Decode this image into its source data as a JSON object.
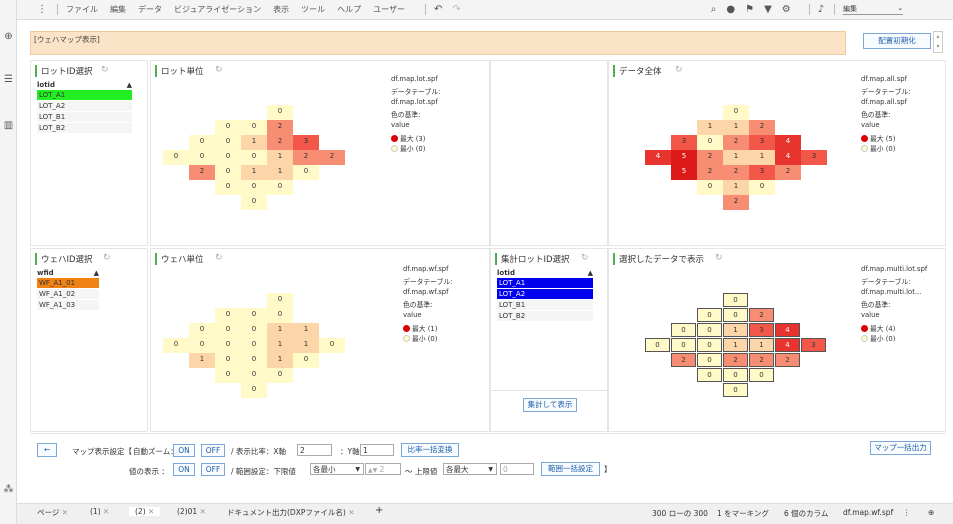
{
  "menu": {
    "items": [
      "ファイル",
      "編集",
      "データ",
      "ビジュアライゼーション",
      "表示",
      "ツール",
      "ヘルプ",
      "ユーザー"
    ],
    "user_label": "編集"
  },
  "banner": {
    "title": "[ウェハマップ表示]",
    "reset_button": "配置初期化"
  },
  "lot_select": {
    "title": "ロットID選択",
    "header": "lotid",
    "items": [
      "LOT_A1",
      "LOT_A2",
      "LOT_B1",
      "LOT_B2"
    ],
    "selected_color": "#22ee22"
  },
  "wafer_select": {
    "title": "ウェハID選択",
    "header": "wfid",
    "items": [
      "WF_A1_01",
      "WF_A1_02",
      "WF_A1_03"
    ],
    "selected_color": "#f08214"
  },
  "agg_select": {
    "title": "集計ロットID選択",
    "header": "lotid",
    "items": [
      "LOT_A1",
      "LOT_A2",
      "LOT_B1",
      "LOT_B2"
    ],
    "selected_color": "#0000ee",
    "button": "集計して表示"
  },
  "map_lot": {
    "title": "ロット単位",
    "file": "df.map.lot.spf",
    "table_label": "データテーブル:",
    "table_value": "df.map.lot.spf",
    "color_label": "色の基準:",
    "color_value": "value",
    "max_label": "最大 (3)",
    "min_label": "最小 (0)",
    "cells": [
      [
        "",
        "",
        "",
        "",
        "0",
        "",
        "",
        ""
      ],
      [
        "",
        "",
        "0",
        "0",
        "2",
        "",
        "",
        ""
      ],
      [
        "",
        "0",
        "0",
        "1",
        "2",
        "3",
        "",
        ""
      ],
      [
        "0",
        "0",
        "0",
        "0",
        "1",
        "2",
        "2",
        ""
      ],
      [
        "",
        "2",
        "0",
        "1",
        "1",
        "0",
        "",
        ""
      ],
      [
        "",
        "",
        "0",
        "0",
        "0",
        "",
        "",
        ""
      ],
      [
        "",
        "",
        "",
        "0",
        "",
        "",
        "",
        ""
      ]
    ]
  },
  "map_all": {
    "title": "データ全体",
    "file": "df.map.all.spf",
    "table_label": "データテーブル:",
    "table_value": "df.map.all.spf",
    "color_label": "色の基準:",
    "color_value": "value",
    "max_label": "最大 (5)",
    "min_label": "最小 (0)",
    "cells": [
      [
        "",
        "",
        "",
        "",
        "0",
        "",
        "",
        ""
      ],
      [
        "",
        "",
        "",
        "1",
        "1",
        "2",
        "",
        ""
      ],
      [
        "",
        "",
        "3",
        "0",
        "2",
        "3",
        "4",
        ""
      ],
      [
        "",
        "4",
        "5",
        "2",
        "1",
        "1",
        "4",
        "3"
      ],
      [
        "",
        "",
        "5",
        "2",
        "2",
        "3",
        "2",
        ""
      ],
      [
        "",
        "",
        "",
        "0",
        "1",
        "0",
        "",
        ""
      ],
      [
        "",
        "",
        "",
        "",
        "2",
        "",
        "",
        ""
      ]
    ]
  },
  "map_wafer": {
    "title": "ウェハ単位",
    "file": "df.map.wf.spf",
    "table_label": "データテーブル:",
    "table_value": "df.map.wf.spf",
    "color_label": "色の基準:",
    "color_value": "value",
    "max_label": "最大 (1)",
    "min_label": "最小 (0)",
    "cells": [
      [
        "",
        "",
        "",
        "",
        "0",
        "",
        "",
        ""
      ],
      [
        "",
        "",
        "0",
        "0",
        "0",
        "",
        "",
        ""
      ],
      [
        "",
        "0",
        "0",
        "0",
        "1",
        "1",
        "",
        ""
      ],
      [
        "0",
        "0",
        "0",
        "0",
        "1",
        "1",
        "0",
        ""
      ],
      [
        "",
        "1",
        "0",
        "0",
        "1",
        "0",
        "",
        ""
      ],
      [
        "",
        "",
        "0",
        "0",
        "0",
        "",
        "",
        ""
      ],
      [
        "",
        "",
        "",
        "0",
        "",
        "",
        "",
        ""
      ]
    ]
  },
  "map_multi": {
    "title": "選択したデータで表示",
    "file": "df.map.multi.lot.spf",
    "table_label": "データテーブル:",
    "table_value": "df.map.multi.lot...",
    "color_label": "色の基準:",
    "color_value": "value",
    "max_label": "最大 (4)",
    "min_label": "最小 (0)",
    "cells": [
      [
        "",
        "",
        "",
        "",
        "0",
        "",
        "",
        ""
      ],
      [
        "",
        "",
        "",
        "0",
        "0",
        "2",
        "",
        ""
      ],
      [
        "",
        "",
        "0",
        "0",
        "1",
        "3",
        "4",
        ""
      ],
      [
        "",
        "0",
        "0",
        "0",
        "1",
        "1",
        "4",
        "3"
      ],
      [
        "",
        "",
        "2",
        "0",
        "2",
        "2",
        "2",
        ""
      ],
      [
        "",
        "",
        "",
        "0",
        "0",
        "0",
        "",
        ""
      ],
      [
        "",
        "",
        "",
        "",
        "0",
        "",
        "",
        ""
      ]
    ]
  },
  "controls": {
    "back": "←",
    "map_setting": "マップ表示設定【",
    "auto_zoom": "自動ズーム：",
    "on": "ON",
    "off": "OFF",
    "ratio_label": "/  表示比率：X軸",
    "x_ratio": "2",
    "y_label": "：Y軸",
    "y_ratio": "1",
    "ratio_button": "比率一括変換",
    "value_display": "値の表示  ：",
    "range_label": "/  範囲設定：下限値",
    "lower_select": "各最小",
    "lower_value": "2",
    "upper_label": "〜 上限値",
    "upper_select": "各最大",
    "upper_value": "0",
    "range_button": "範囲一括設定",
    "bracket": "】",
    "bulk_output": "マップ一括出力"
  },
  "tabs": [
    "ページ",
    "(1)",
    "(2)",
    "(2)01",
    "ドキュメント出力(DXPファイル名)"
  ],
  "status": {
    "rows": "300 ローの 300",
    "marking": "1 をマーキング",
    "columns": "6 個のカラム",
    "file": "df.map.wf.spf"
  },
  "colors": {
    "v0": "#fffac8",
    "v1": "#fcd5a8",
    "v2": "#f78e74",
    "v3": "#f2574a",
    "v4": "#e8342e",
    "v5": "#dd1a1a",
    "max": "#dd0000",
    "min": "#fffac8"
  }
}
